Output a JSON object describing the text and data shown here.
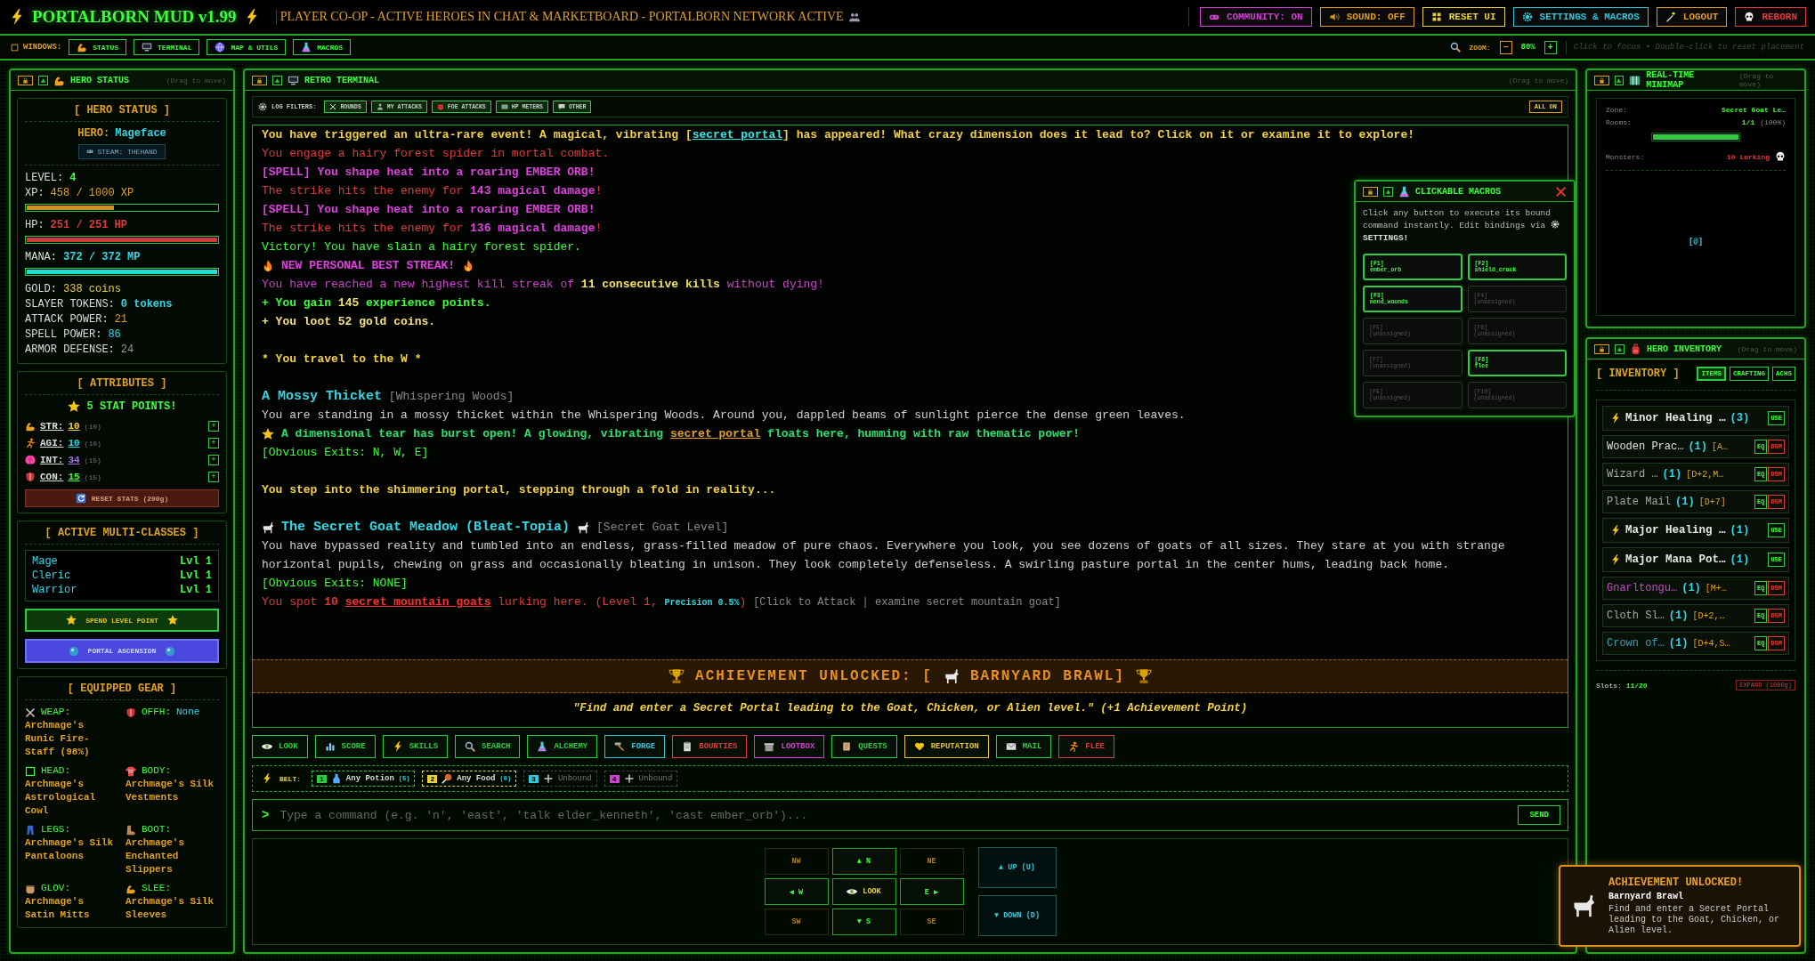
{
  "header": {
    "title": "PORTALBORN MUD v1.99",
    "ticker": "PLAYER CO-OP - ACTIVE HEROES IN CHAT & MARKETBOARD - PORTALBORN NETWORK ACTIVE",
    "buttons": [
      {
        "label": "COMMUNITY: ON",
        "color": "#d040d0"
      },
      {
        "label": "SOUND: OFF",
        "color": "#e09a20"
      },
      {
        "label": "RESET UI",
        "color": "#e8d040"
      },
      {
        "label": "SETTINGS & MACROS",
        "color": "#30c8d8"
      },
      {
        "label": "LOGOUT",
        "color": "#e09a20"
      },
      {
        "label": "REBORN",
        "color": "#e03a3a"
      }
    ]
  },
  "toolbar": {
    "label": "WINDOWS:",
    "windows": [
      "STATUS",
      "TERMINAL",
      "MAP & UTILS",
      "MACROS"
    ],
    "zoom_label": "ZOOM:",
    "zoom_out": "−",
    "zoom_value": "80%",
    "zoom_in": "+",
    "hint": "Click to focus • Double-click to reset placement"
  },
  "hero_panel": {
    "title": "HERO STATUS",
    "drag_hint": "(Drag to move)",
    "status": {
      "heading": "[ HERO STATUS ]",
      "hero_label": "HERO:",
      "hero_name": "Mageface",
      "badge": "STEAM: THEHAND",
      "stats": [
        {
          "label": "LEVEL:",
          "value": "4",
          "kind": "level"
        },
        {
          "label": "XP:",
          "value": "458 / 1000 XP",
          "kind": "xp",
          "level": 0.458
        },
        {
          "label": "HP:",
          "value": "251 / 251 HP",
          "kind": "hp",
          "level": 1
        },
        {
          "label": "MANA:",
          "value": "372 / 372 MP",
          "kind": "mana",
          "level": 1
        },
        {
          "label": "GOLD:",
          "value": "338 coins",
          "kind": "gold"
        },
        {
          "label": "SLAYER TOKENS:",
          "value": "0 tokens",
          "kind": "tokens"
        },
        {
          "label": "ATTACK POWER:",
          "value": "21",
          "kind": "attack"
        },
        {
          "label": "SPELL POWER:",
          "value": "86",
          "kind": "spell"
        },
        {
          "label": "ARMOR DEFENSE:",
          "value": "24",
          "kind": "armor"
        }
      ]
    },
    "attributes": {
      "heading": "[ ATTRIBUTES ]",
      "points": "5 STAT POINTS!",
      "stats": [
        {
          "label": "STR:",
          "value": "10",
          "base": "(10)",
          "plus": "+",
          "color": "#f5d142"
        },
        {
          "label": "AGI:",
          "value": "10",
          "base": "(10)",
          "plus": "+",
          "color": "#30d8e8"
        },
        {
          "label": "INT:",
          "value": "34",
          "base": "(15)",
          "plus": "+",
          "color": "#b070f0"
        },
        {
          "label": "CON:",
          "value": "15",
          "base": "(15)",
          "plus": "+",
          "color": "#3cff3c"
        }
      ],
      "reset": "RESET STATS (200g)"
    },
    "classes": {
      "heading": "[ ACTIVE MULTI-CLASSES ]",
      "rows": [
        {
          "name": "Mage",
          "rank": "Lvl 1"
        },
        {
          "name": "Cleric",
          "rank": "Lvl 1"
        },
        {
          "name": "Warrior",
          "rank": "Lvl 1"
        }
      ],
      "spend": "SPEND LEVEL POINT",
      "ascend": "PORTAL ASCENSION"
    },
    "gear": {
      "heading": "[ EQUIPPED GEAR ]",
      "slots": [
        {
          "kind": "weapon",
          "label": "WEAP:",
          "item": "Archmage's Runic Fire-Staff (98%)",
          "empty": false
        },
        {
          "kind": "offhand",
          "label": "OFFH:",
          "item": "None",
          "empty": true
        },
        {
          "kind": "head",
          "label": "HEAD:",
          "item": "Archmage's Astrological Cowl",
          "empty": false
        },
        {
          "kind": "body",
          "label": "BODY:",
          "item": "Archmage's Silk Vestments",
          "empty": false
        },
        {
          "kind": "legs",
          "label": "LEGS:",
          "item": "Archmage's Silk Pantaloons",
          "empty": false
        },
        {
          "kind": "boots",
          "label": "BOOT:",
          "item": "Archmage's Enchanted Slippers",
          "empty": false
        },
        {
          "kind": "gloves",
          "label": "GLOV:",
          "item": "Archmage's Satin Mitts",
          "empty": false
        },
        {
          "kind": "sleeves",
          "label": "SLEE:",
          "item": "Archmage's Silk Sleeves",
          "empty": false
        }
      ]
    }
  },
  "terminal": {
    "title": "RETRO TERMINAL",
    "drag_hint": "(Drag to move)",
    "filters_label": "LOG FILTERS:",
    "filters": [
      {
        "label": "ROUNDS",
        "on": true
      },
      {
        "label": "MY ATTACKS",
        "on": true
      },
      {
        "label": "FOE ATTACKS",
        "on": true
      },
      {
        "label": "HP METERS",
        "on": true
      },
      {
        "label": "OTHER",
        "on": true
      }
    ],
    "all_on": "ALL ON",
    "log": [
      {
        "kind": "plain",
        "parts": [
          {
            "text": "You have triggered an ultra-rare event! A magical, vibrating [",
            "kind": "event"
          },
          {
            "text": "secret portal",
            "kind": "portal-link"
          },
          {
            "text": "] has appeared! What crazy dimension does it lead to? Click on it or examine it to explore!",
            "kind": "event"
          }
        ]
      },
      {
        "kind": "plain",
        "parts": [
          {
            "text": "You engage a hairy forest spider in mortal combat.",
            "kind": "combat"
          }
        ]
      },
      {
        "kind": "plain",
        "parts": [
          {
            "text": "[SPELL] You shape heat into a roaring EMBER ORB!",
            "kind": "spell"
          }
        ]
      },
      {
        "kind": "plain",
        "parts": [
          {
            "text": "The strike hits the enemy for ",
            "kind": "combat"
          },
          {
            "text": "143 magical damage",
            "kind": "spell"
          },
          {
            "text": "!",
            "kind": "combat"
          }
        ]
      },
      {
        "kind": "plain",
        "parts": [
          {
            "text": "[SPELL] You shape heat into a roaring EMBER ORB!",
            "kind": "spell"
          }
        ]
      },
      {
        "kind": "plain",
        "parts": [
          {
            "text": "The strike hits the enemy for ",
            "kind": "combat"
          },
          {
            "text": "136 magical damage",
            "kind": "spell"
          },
          {
            "text": "!",
            "kind": "combat"
          }
        ]
      },
      {
        "kind": "plain",
        "parts": [
          {
            "text": "Victory! You have slain a hairy forest spider.",
            "kind": "victory"
          }
        ]
      },
      {
        "kind": "streak",
        "parts": [
          {
            "text": "NEW PERSONAL BEST STREAK!",
            "kind": "spell"
          }
        ]
      },
      {
        "kind": "plain",
        "parts": [
          {
            "text": "You have reached a new highest kill streak of ",
            "kind": "streak"
          },
          {
            "text": "11 consecutive kills",
            "kind": "highlight"
          },
          {
            "text": " without dying!",
            "kind": "streak"
          }
        ]
      },
      {
        "kind": "plain",
        "parts": [
          {
            "text": "+ You gain ",
            "kind": "gain"
          },
          {
            "text": "145",
            "kind": "highlight"
          },
          {
            "text": " experience points.",
            "kind": "gain"
          }
        ]
      },
      {
        "kind": "plain",
        "parts": [
          {
            "text": "+ You loot 52 gold coins.",
            "kind": "loot"
          }
        ]
      },
      {
        "kind": "travel",
        "parts": [
          {
            "text": "* You travel to the W *",
            "kind": "event"
          }
        ]
      },
      {
        "kind": "room",
        "parts": [
          {
            "text": "A Mossy Thicket",
            "kind": "room"
          },
          {
            "text": " [Whispering Woods]",
            "kind": "zone"
          }
        ]
      },
      {
        "kind": "plain",
        "parts": [
          {
            "text": "You are standing in a mossy thicket within the Whispering Woods. Around you, dappled beams of sunlight pierce the dense green leaves.",
            "kind": "desc"
          }
        ]
      },
      {
        "kind": "dimension",
        "parts": [
          {
            "text": "A dimensional tear has burst open! A glowing, vibrating ",
            "kind": "dimension"
          },
          {
            "text": "secret portal",
            "kind": "gold-link"
          },
          {
            "text": " floats here, humming with raw thematic power!",
            "kind": "dimension"
          }
        ]
      },
      {
        "kind": "plain",
        "parts": [
          {
            "text": "[Obvious Exits: N, W, E]",
            "kind": "exits"
          }
        ]
      },
      {
        "kind": "travel",
        "parts": [
          {
            "text": "You step into the shimmering portal, stepping through a fold in reality...",
            "kind": "event"
          }
        ]
      },
      {
        "kind": "goat-room",
        "parts": [
          {
            "text": "The Secret Goat Meadow (Bleat-Topia)",
            "kind": "room"
          },
          {
            "text": "[Secret Goat Level]",
            "kind": "zone"
          }
        ]
      },
      {
        "kind": "plain",
        "parts": [
          {
            "text": "You have bypassed reality and tumbled into an endless, grass-filled meadow of pure chaos. Everywhere you look, you see dozens of goats of all sizes. They stare at you with strange horizontal pupils, chewing on grass and occasionally bleating in unison. They look completely defenseless. A swirling pasture portal in the center hums, leading back home.",
            "kind": "desc"
          }
        ]
      },
      {
        "kind": "plain",
        "parts": [
          {
            "text": "[Obvious Exits: NONE]",
            "kind": "exits"
          }
        ]
      },
      {
        "kind": "plain",
        "parts": [
          {
            "text": "You spot ",
            "kind": "combat"
          },
          {
            "text": "10 ",
            "kind": "count"
          },
          {
            "text": "secret mountain goats",
            "kind": "enemy-link"
          },
          {
            "text": " lurking here. (Level 1, ",
            "kind": "combat"
          },
          {
            "text": "Precision 0.5%",
            "kind": "precision"
          },
          {
            "text": ") ",
            "kind": "combat"
          },
          {
            "text": "[Click to Attack | examine secret mountain goat]",
            "kind": "hint"
          }
        ]
      }
    ],
    "achievement": {
      "title": "ACHIEVEMENT UNLOCKED: [",
      "name": "BARNYARD BRAWL]",
      "quote": "\"Find and enter a Secret Portal leading to the Goat, Chicken, or Alien level.\" (+1 Achievement Point)"
    },
    "commands": [
      {
        "label": "LOOK",
        "color": "#2ecc40"
      },
      {
        "label": "SCORE",
        "color": "#2ecc40"
      },
      {
        "label": "SKILLS",
        "color": "#2ecc40"
      },
      {
        "label": "SEARCH",
        "color": "#2ecc40"
      },
      {
        "label": "ALCHEMY",
        "color": "#2ecc40"
      },
      {
        "label": "FORGE",
        "color": "#30c8d8"
      },
      {
        "label": "BOUNTIES",
        "color": "#e03a3a"
      },
      {
        "label": "LOOTBOX",
        "color": "#d040d0"
      },
      {
        "label": "QUESTS",
        "color": "#2ecc40"
      },
      {
        "label": "REPUTATION",
        "color": "#e8c030"
      },
      {
        "label": "MAIL",
        "color": "#2ecc40"
      },
      {
        "label": "FLEE",
        "color": "#e03a3a"
      }
    ],
    "belt": {
      "label": "BELT:",
      "slots": [
        {
          "key": "1",
          "label": "Any Potion",
          "count": "(5)",
          "color": "#2ecc40",
          "bound": true
        },
        {
          "key": "2",
          "label": "Any Food",
          "count": "(0)",
          "color": "#e8d040",
          "bound": true
        },
        {
          "key": "3",
          "label": "Unbound",
          "color": "#30c8d8",
          "bound": false
        },
        {
          "key": "4",
          "label": "Unbound",
          "color": "#d040d0",
          "bound": false
        }
      ]
    },
    "input": {
      "prompt": ">",
      "placeholder": "Type a command (e.g. 'n', 'east', 'talk elder_kenneth', 'cast ember_orb')...",
      "send": "SEND"
    },
    "compass": [
      {
        "label": "NW",
        "kind": "dir",
        "available": false
      },
      {
        "label": "▲ N",
        "kind": "dir",
        "available": true
      },
      {
        "label": "NE",
        "kind": "dir",
        "available": false
      },
      {
        "label": "◀ W",
        "kind": "dir",
        "available": true
      },
      {
        "label": "LOOK",
        "kind": "look",
        "available": true
      },
      {
        "label": "E ▶",
        "kind": "dir",
        "available": true
      },
      {
        "label": "SW",
        "kind": "dir",
        "available": false
      },
      {
        "label": "▼ S",
        "kind": "dir",
        "available": true
      },
      {
        "label": "SE",
        "kind": "dir",
        "available": false
      }
    ],
    "vertical": [
      "▲ UP (U)",
      "▼ DOWN (D)"
    ]
  },
  "macros": {
    "title": "CLICKABLE MACROS",
    "help": "Click any button to execute its bound command instantly. Edit bindings via",
    "help_link": "SETTINGS!",
    "slots": [
      {
        "key": "[F1]",
        "command": "ember_orb",
        "bound": true
      },
      {
        "key": "[F2]",
        "command": "shield_crack",
        "bound": true
      },
      {
        "key": "[F3]",
        "command": "mend_wounds",
        "bound": true
      },
      {
        "key": "[F4]",
        "command": "(unassigned)",
        "bound": false
      },
      {
        "key": "[F5]",
        "command": "(unassigned)",
        "bound": false
      },
      {
        "key": "[F6]",
        "command": "(unassigned)",
        "bound": false
      },
      {
        "key": "[F7]",
        "command": "(unassigned)",
        "bound": false
      },
      {
        "key": "[F8]",
        "command": "flee",
        "bound": true
      },
      {
        "key": "[F9]",
        "command": "(unassigned)",
        "bound": false
      },
      {
        "key": "[F10]",
        "command": "(unassigned)",
        "bound": false
      }
    ]
  },
  "minimap": {
    "title": "REAL-TIME MINIMAP",
    "drag_hint": "(Drag to move)",
    "zone_label": "Zone:",
    "zone": "Secret Goat Le…",
    "rooms_label": "Rooms:",
    "rooms": "1/1",
    "rooms_pct": "(100%)",
    "explored": {
      "level": 1
    },
    "monsters_label": "Monsters:",
    "monsters": "10 Lurking",
    "player": "[@]"
  },
  "inventory": {
    "title": "HERO INVENTORY",
    "drag_hint": "(Drag to move)",
    "heading": "[ INVENTORY ]",
    "tabs": [
      {
        "label": "ITEMS",
        "selected": true
      },
      {
        "label": "CRAFTING",
        "selected": false
      },
      {
        "label": "ACHS",
        "selected": false
      }
    ],
    "items": [
      {
        "kind": "consumable",
        "name": "Minor Healing …",
        "count": "(3)",
        "color": "#e8e8e8",
        "actions": [
          "USE"
        ]
      },
      {
        "kind": "gear",
        "name": "Wooden Prac…",
        "count": "(1)",
        "stats": "[A…",
        "color": "#e0e0e0",
        "actions": [
          "EQ",
          "DSM"
        ]
      },
      {
        "kind": "gear",
        "name": "Wizard …",
        "count": "(1)",
        "stats": "[D+2,M…",
        "color": "#a8a8a8",
        "actions": [
          "EQ",
          "DSM"
        ]
      },
      {
        "kind": "gear",
        "name": "Plate Mail",
        "count": "(1)",
        "stats": "[D+7]",
        "color": "#a8a8a8",
        "actions": [
          "EQ",
          "DSM"
        ]
      },
      {
        "kind": "consumable",
        "name": "Major Healing …",
        "count": "(1)",
        "color": "#e8e8e8",
        "actions": [
          "USE"
        ]
      },
      {
        "kind": "consumable",
        "name": "Major Mana Pot…",
        "count": "(1)",
        "color": "#e8e8e8",
        "actions": [
          "USE"
        ]
      },
      {
        "kind": "gear",
        "name": "Gnarltongu…",
        "count": "(1)",
        "stats": "[M+…",
        "color": "#c050c0",
        "actions": [
          "EQ",
          "DSM"
        ]
      },
      {
        "kind": "gear",
        "name": "Cloth Sl…",
        "count": "(1)",
        "stats": "[D+2,…",
        "color": "#a8a8a8",
        "actions": [
          "EQ",
          "DSM"
        ]
      },
      {
        "kind": "gear",
        "name": "Crown of…",
        "count": "(1)",
        "stats": "[D+4,S…",
        "color": "#3aa0b8",
        "actions": [
          "EQ",
          "DSM"
        ]
      }
    ],
    "slots_label": "Slots:",
    "slots": "11/20",
    "expand": "EXPAND (1000g)"
  },
  "toast": {
    "title": "ACHIEVEMENT UNLOCKED!",
    "name": "Barnyard Brawl",
    "text": "Find and enter a Secret Portal leading to the Goat, Chicken, or Alien level."
  }
}
